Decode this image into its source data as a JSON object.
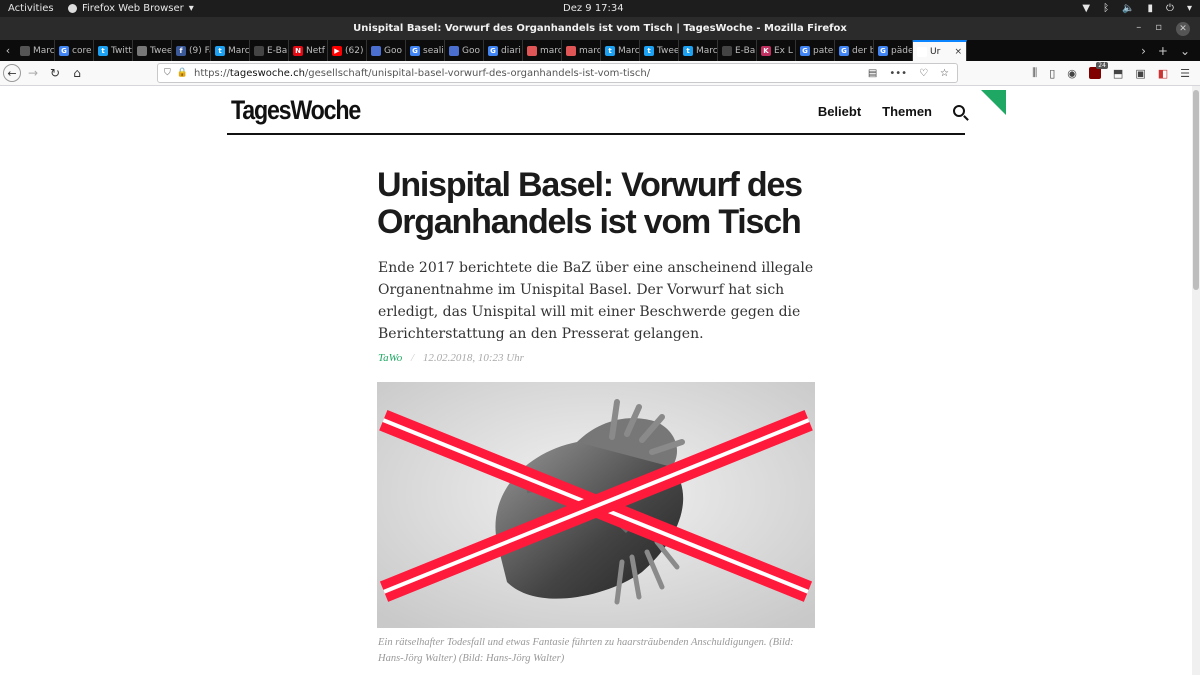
{
  "system": {
    "activities": "Activities",
    "app_name": "Firefox Web Browser",
    "clock": "Dez 9  17:34"
  },
  "window": {
    "title": "Unispital Basel: Vorwurf des Organhandels ist vom Tisch | TagesWoche - Mozilla Firefox"
  },
  "tabs": [
    {
      "label": "Marc",
      "fav": "",
      "color": "#555555"
    },
    {
      "label": "core",
      "fav": "G",
      "color": "#4285f4"
    },
    {
      "label": "Twitt",
      "fav": "t",
      "color": "#1da1f2"
    },
    {
      "label": "Twee",
      "fav": "",
      "color": "#777777"
    },
    {
      "label": "(9) Fa",
      "fav": "f",
      "color": "#3b5998"
    },
    {
      "label": "Marc",
      "fav": "t",
      "color": "#1da1f2"
    },
    {
      "label": "E-Ba",
      "fav": "",
      "color": "#444444"
    },
    {
      "label": "Netf",
      "fav": "N",
      "color": "#e50914"
    },
    {
      "label": "(62)",
      "fav": "▶",
      "color": "#ff0000"
    },
    {
      "label": "Goo",
      "fav": "",
      "color": "#4a6fd1"
    },
    {
      "label": "seali",
      "fav": "G",
      "color": "#4285f4"
    },
    {
      "label": "Goo",
      "fav": "",
      "color": "#4a6fd1"
    },
    {
      "label": "diari",
      "fav": "G",
      "color": "#4285f4"
    },
    {
      "label": "marc",
      "fav": "",
      "color": "#e05555"
    },
    {
      "label": "marc",
      "fav": "",
      "color": "#e05555"
    },
    {
      "label": "Marc",
      "fav": "t",
      "color": "#1da1f2"
    },
    {
      "label": "Twee",
      "fav": "t",
      "color": "#1da1f2"
    },
    {
      "label": "Marc",
      "fav": "t",
      "color": "#1da1f2"
    },
    {
      "label": "E-Ba",
      "fav": "",
      "color": "#444444"
    },
    {
      "label": "Ex L",
      "fav": "K",
      "color": "#c03060"
    },
    {
      "label": "pate",
      "fav": "G",
      "color": "#4285f4"
    },
    {
      "label": "der b",
      "fav": "G",
      "color": "#4285f4"
    },
    {
      "label": "päde",
      "fav": "G",
      "color": "#4285f4"
    }
  ],
  "active_tab": {
    "label": "Ur",
    "close": "×",
    "color": "#1fa863"
  },
  "toolbar": {
    "url_prefix": "https://",
    "url_host": "tageswoche.ch",
    "url_path": "/gesellschaft/unispital-basel-vorwurf-des-organhandels-ist-vom-tisch/",
    "ublock_count": "24"
  },
  "site": {
    "logo": "TagesWoche",
    "nav_popular": "Beliebt",
    "nav_topics": "Themen",
    "accent": "#1fa863"
  },
  "article": {
    "headline": "Unispital Basel: Vorwurf des Organhandels ist vom Tisch",
    "lead": "Ende 2017 berichtete die BaZ über eine anscheinend illegale Organentnahme im Unispital Basel. Der Vorwurf hat sich erledigt, das Unispital will mit einer Beschwerde gegen die Berichterstattung an den Presserat gelangen.",
    "author": "TaWo",
    "separator": "/",
    "date": "12.02.2018,  10:23 Uhr",
    "caption": "Ein rätselhafter Todesfall und etwas Fantasie führten zu haarsträubenden Anschuldigungen. (Bild: Hans-Jörg Walter) (Bild: Hans-Jörg Walter)"
  }
}
